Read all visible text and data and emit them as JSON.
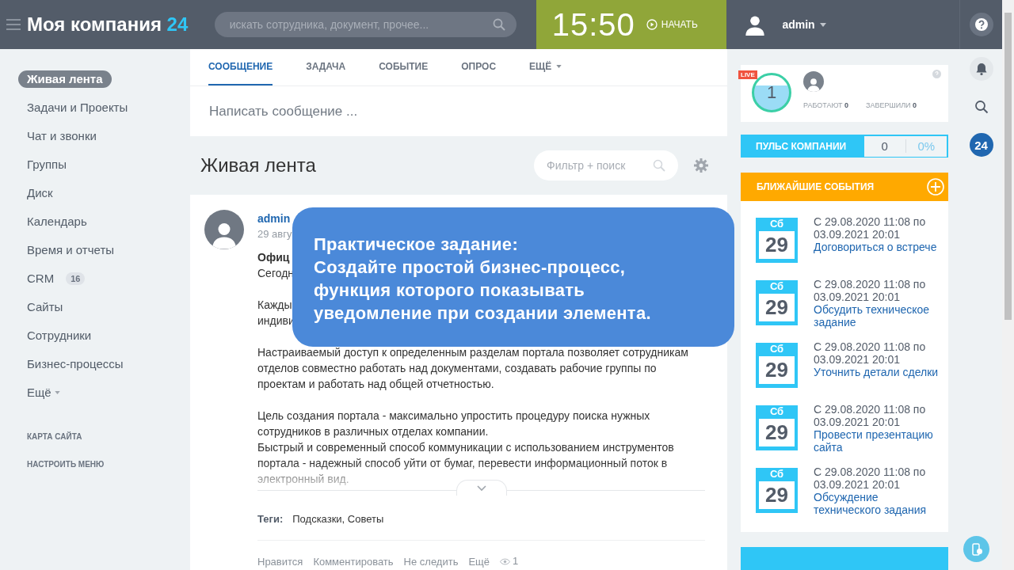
{
  "header": {
    "logo_name": "Моя компания",
    "logo_suffix": "24",
    "search_placeholder": "искать сотрудника, документ, прочее...",
    "time": "15:50",
    "start_label": "НАЧАТЬ",
    "user_name": "admin"
  },
  "sidebar": {
    "items": [
      {
        "label": "Живая лента",
        "selected": true
      },
      {
        "label": "Задачи и Проекты",
        "selected": false
      },
      {
        "label": "Чат и звонки",
        "selected": false
      },
      {
        "label": "Группы",
        "selected": false
      },
      {
        "label": "Диск",
        "selected": false
      },
      {
        "label": "Календарь",
        "selected": false
      },
      {
        "label": "Время и отчеты",
        "selected": false
      },
      {
        "label": "CRM",
        "selected": false,
        "counter": "16"
      },
      {
        "label": "Сайты",
        "selected": false
      },
      {
        "label": "Сотрудники",
        "selected": false
      },
      {
        "label": "Бизнес-процессы",
        "selected": false
      },
      {
        "label": "Ещё",
        "selected": false,
        "dropdown": true
      }
    ],
    "links": [
      "КАРТА САЙТА",
      "НАСТРОИТЬ МЕНЮ"
    ]
  },
  "composer": {
    "tabs": [
      {
        "label": "СООБЩЕНИЕ",
        "selected": true,
        "dropdown": false
      },
      {
        "label": "ЗАДАЧА",
        "selected": false,
        "dropdown": false
      },
      {
        "label": "СОБЫТИЕ",
        "selected": false,
        "dropdown": false
      },
      {
        "label": "ОПРОС",
        "selected": false,
        "dropdown": false
      },
      {
        "label": "ЕЩЁ",
        "selected": false,
        "dropdown": true
      }
    ],
    "placeholder": "Написать сообщение ..."
  },
  "feed": {
    "title": "Живая лента",
    "filter_placeholder": "Фильтр + поиск"
  },
  "post": {
    "author": "admin",
    "date": "29 авгу",
    "title": "Офиц",
    "lines": [
      [
        "Сегодн"
      ],
      [
        "Кажды",
        "индиви"
      ]
    ],
    "paragraphs": [
      "Настраиваемый доступ к определенным разделам портала позволяет сотрудникам отделов совместно работать над документами, создавать рабочие группы по проектам и работать над общей отчетностью.",
      "Цель создания портала - максимально упростить процедуру поиска нужных сотрудников в различных отделах компании.",
      "Быстрый и современный способ коммуникации с использованием инструментов портала - надежный способ уйти от бумаг, перевести информационный поток в электронный вид."
    ],
    "tags_label": "Теги:",
    "tags": "Подсказки, Советы",
    "actions": [
      "Нравится",
      "Комментировать",
      "Не следить",
      "Ещё"
    ],
    "views": "1"
  },
  "callout": {
    "lines": [
      "Практическое задание:",
      "Создайте простой бизнес-процесс,",
      "функция которого показывать",
      "уведомление при создании элемента."
    ]
  },
  "pulse": {
    "live": "LIVE",
    "count": "1",
    "working_label": "РАБОТАЮТ",
    "working": "0",
    "finished_label": "ЗАВЕРШИЛИ",
    "finished": "0",
    "title": "ПУЛЬС КОМПАНИИ",
    "value": "0",
    "percent": "0%"
  },
  "events": {
    "title": "БЛИЖАЙШИЕ СОБЫТИЯ",
    "items": [
      {
        "weekday": "Сб",
        "day": "29",
        "time": "С 29.08.2020 11:08 по 03.09.2021 20:01",
        "title": "Договориться о встрече"
      },
      {
        "weekday": "Сб",
        "day": "29",
        "time": "С 29.08.2020 11:08 по 03.09.2021 20:01",
        "title": "Обсудить техническое задание"
      },
      {
        "weekday": "Сб",
        "day": "29",
        "time": "С 29.08.2020 11:08 по 03.09.2021 20:01",
        "title": "Уточнить детали сделки"
      },
      {
        "weekday": "Сб",
        "day": "29",
        "time": "С 29.08.2020 11:08 по 03.09.2021 20:01",
        "title": "Провести презентацию сайта"
      },
      {
        "weekday": "Сб",
        "day": "29",
        "time": "С 29.08.2020 11:08 по 03.09.2021 20:01",
        "title": "Обсуждение технического задания"
      }
    ]
  },
  "rail": {
    "badge": "24"
  }
}
